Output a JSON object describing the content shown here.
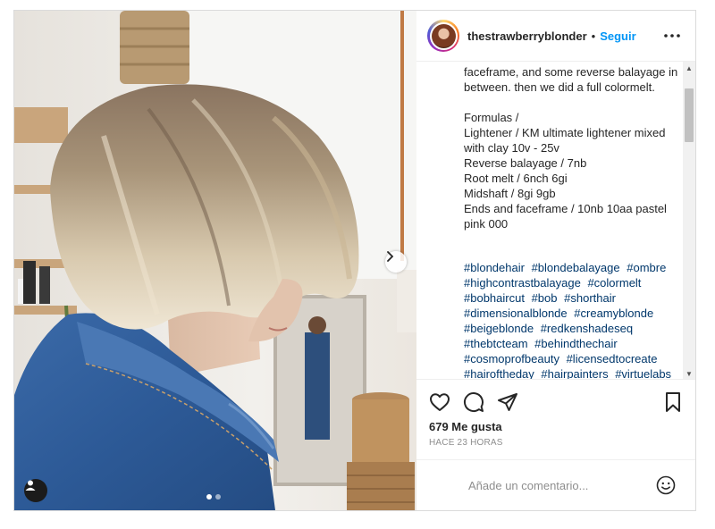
{
  "post": {
    "media": {
      "slide_count": 2,
      "active_slide": 1,
      "next_icon": "chevron-right-icon",
      "tag_icon": "user-tag-icon"
    },
    "header": {
      "username": "thestrawberryblonder",
      "separator": "•",
      "follow_label": "Seguir",
      "more_icon": "more-horizontal-icon"
    },
    "caption": {
      "text": "faceframe, and some reverse balayage in between. then we did a full colormelt.\n\nFormulas /\nLightener / KM ultimate lightener mixed with clay 10v - 25v\nReverse balayage / 7nb\nRoot melt / 6nch 6gi\nMidshaft / 8gi 9gb\nEnds and faceframe / 10nb 10aa pastel pink 000",
      "hashtags": [
        "#blondehair",
        "#blondebalayage",
        "#ombre",
        "#highcontrastbalayage",
        "#colormelt",
        "#bobhaircut",
        "#bob",
        "#shorthair",
        "#dimensionalblonde",
        "#creamyblonde",
        "#beigeblonde",
        "#redkenshadeseq",
        "#thebtcteam",
        "#behindthechair",
        "#cosmoprofbeauty",
        "#licensedtocreate",
        "#hairoftheday",
        "#hairpainters",
        "#virtuelabs"
      ]
    },
    "actions": {
      "like_icon": "heart-icon",
      "comment_icon": "comment-icon",
      "share_icon": "share-icon",
      "save_icon": "bookmark-icon"
    },
    "likes_text": "679 Me gusta",
    "time_text": "HACE 23 HORAS",
    "comment": {
      "placeholder": "Añade un comentario...",
      "emoji_icon": "emoji-icon"
    },
    "colors": {
      "link_blue": "#0095f6",
      "hashtag_blue": "#00376b",
      "text": "#262626",
      "muted": "#8e8e8e"
    }
  }
}
